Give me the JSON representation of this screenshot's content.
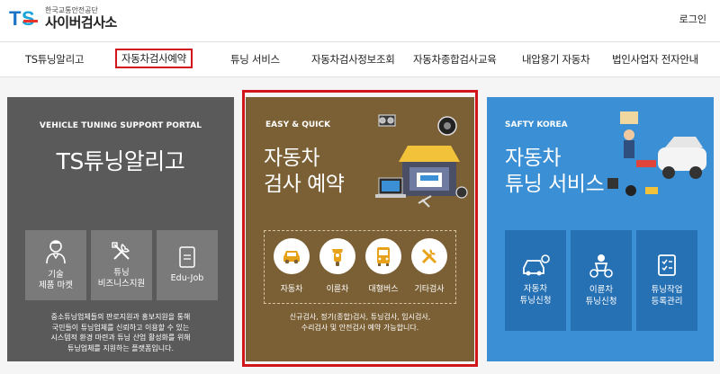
{
  "header": {
    "logo_mark": "TS",
    "logo_sub": "한국교통안전공단",
    "logo_main": "사이버검사소",
    "login": "로그인"
  },
  "nav": {
    "items": [
      {
        "label": "TS튜닝알리고"
      },
      {
        "label": "자동차검사예약"
      },
      {
        "label": "튜닝 서비스"
      },
      {
        "label": "자동차검사정보조회"
      },
      {
        "label": "자동차종합검사교육"
      },
      {
        "label": "내압용기 자동차"
      },
      {
        "label": "법인사업자 전자안내"
      }
    ],
    "active_index": 1
  },
  "panels": {
    "tuning": {
      "eyebrow": "VEHICLE TUNING SUPPORT PORTAL",
      "title": "TS튜닝알리고",
      "tiles": [
        {
          "label": "기술\n제품 마켓",
          "icon": "mechanic-icon"
        },
        {
          "label": "튜닝\n비즈니스지원",
          "icon": "tools-icon"
        },
        {
          "label": "Edu-Job",
          "icon": "document-icon"
        }
      ],
      "desc": "중소튜닝업체들의 판로지원과 홍보지원을 통해\n국민들이 튜닝업체를 신뢰하고 이용할 수 있는\n시스템적 환경 마련과 튜닝 산업 활성화를 위해\n튜닝업체를 지원하는 플랫폼입니다."
    },
    "reservation": {
      "eyebrow": "EASY & QUICK",
      "title_line1": "자동차",
      "title_line2": "검사 예약",
      "options": [
        {
          "label": "자동차",
          "icon": "car-icon"
        },
        {
          "label": "이륜차",
          "icon": "motorcycle-icon"
        },
        {
          "label": "대형버스",
          "icon": "bus-icon"
        },
        {
          "label": "기타검사",
          "icon": "tools-icon"
        }
      ],
      "desc": "신규검사, 정기(종합)검사, 튜닝검사, 임시검사,\n수리검사 및 안전검사 예약 가능합니다."
    },
    "service": {
      "eyebrow": "SAFTY KOREA",
      "title_line1": "자동차",
      "title_line2": "튜닝 서비스",
      "tiles": [
        {
          "label": "자동차\n튜닝신청",
          "icon": "car-tuning-icon"
        },
        {
          "label": "이륜차\n튜닝신청",
          "icon": "motorcycle-rider-icon"
        },
        {
          "label": "튜닝작업\n등록관리",
          "icon": "checklist-icon"
        }
      ]
    }
  },
  "colors": {
    "accent_red": "#d0151b",
    "panel_gray": "#5a5a5a",
    "panel_brown": "#7b6035",
    "panel_blue": "#3b8fd4"
  }
}
